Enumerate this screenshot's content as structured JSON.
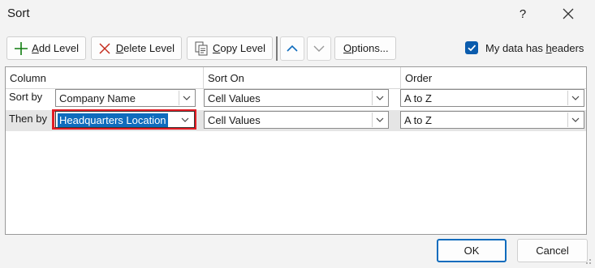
{
  "window": {
    "title": "Sort",
    "help_label": "?"
  },
  "toolbar": {
    "add_level": {
      "first": "A",
      "rest": "dd Level"
    },
    "delete_level": {
      "first": "D",
      "rest": "elete Level"
    },
    "copy_level": {
      "first": "C",
      "rest": "opy Level"
    },
    "options": {
      "first": "O",
      "rest": "ptions..."
    },
    "has_headers": {
      "checked": true,
      "before": "My data has ",
      "underlined": "h",
      "after": "eaders"
    }
  },
  "grid": {
    "columns": [
      "Column",
      "Sort On",
      "Order"
    ],
    "rows": [
      {
        "label": "Sort by",
        "column": "Company Name",
        "sort_on": "Cell Values",
        "order": "A to Z"
      },
      {
        "label": "Then by",
        "column": "Headquarters Location",
        "sort_on": "Cell Values",
        "order": "A to Z"
      }
    ]
  },
  "footer": {
    "ok": "OK",
    "cancel": "Cancel"
  },
  "colors": {
    "accent": "#0f6cbd",
    "highlight_frame": "#e31c24",
    "add_icon": "#107c10",
    "delete_icon": "#c42b1c",
    "selected_row": "#e5e5e5"
  }
}
